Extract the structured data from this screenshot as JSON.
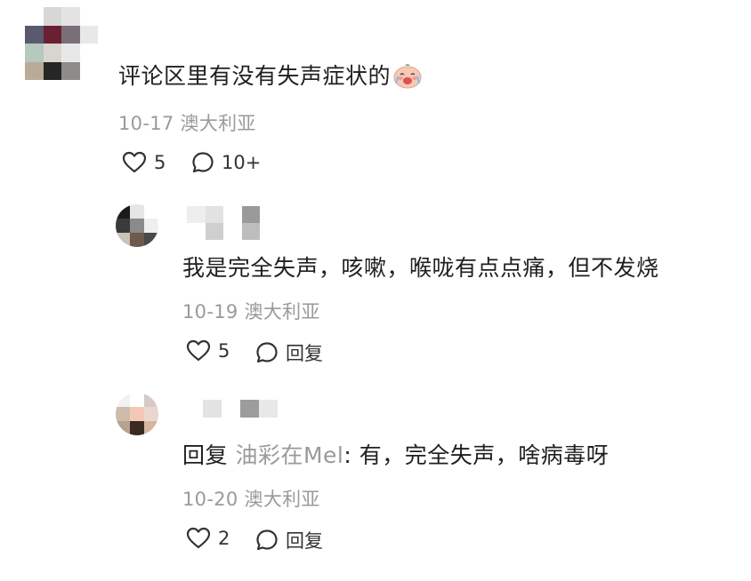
{
  "comment": {
    "text": "评论区里有没有失声症状的",
    "emoji": "crying-face-emoji",
    "date": "10-17",
    "location": "澳大利亚",
    "likes": "5",
    "replies_count": "10+"
  },
  "replies": [
    {
      "text": "我是完全失声，咳嗽，喉咙有点点痛，但不发烧",
      "date": "10-19",
      "location": "澳大利亚",
      "likes": "5",
      "reply_label": "回复"
    },
    {
      "prefix": "回复",
      "reply_to": "油彩在Mel",
      "text": ": 有，完全失声，啥病毒呀",
      "date": "10-20",
      "location": "澳大利亚",
      "likes": "2",
      "reply_label": "回复"
    }
  ],
  "colors": {
    "text": "#1f1f1f",
    "meta": "#9a9a9a",
    "background": "#ffffff"
  }
}
